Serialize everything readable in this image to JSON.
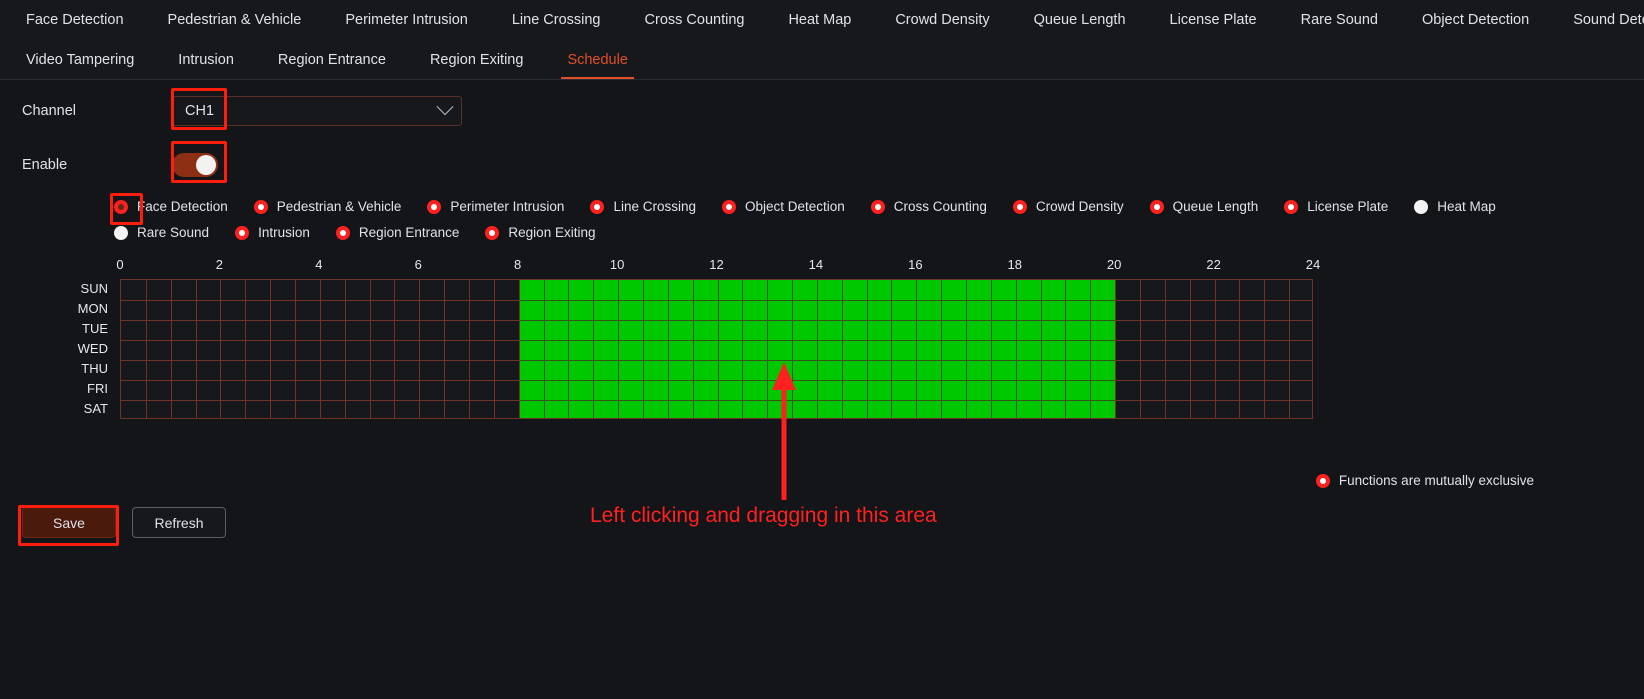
{
  "nav": {
    "row1": [
      {
        "label": "Face Detection",
        "active": false
      },
      {
        "label": "Pedestrian & Vehicle",
        "active": false
      },
      {
        "label": "Perimeter Intrusion",
        "active": false
      },
      {
        "label": "Line Crossing",
        "active": false
      },
      {
        "label": "Cross Counting",
        "active": false
      },
      {
        "label": "Heat Map",
        "active": false
      },
      {
        "label": "Crowd Density",
        "active": false
      },
      {
        "label": "Queue Length",
        "active": false
      },
      {
        "label": "License Plate",
        "active": false
      },
      {
        "label": "Rare Sound",
        "active": false
      },
      {
        "label": "Object Detection",
        "active": false
      },
      {
        "label": "Sound Detection",
        "active": false
      }
    ],
    "row2": [
      {
        "label": "Video Tampering",
        "active": false
      },
      {
        "label": "Intrusion",
        "active": false
      },
      {
        "label": "Region Entrance",
        "active": false
      },
      {
        "label": "Region Exiting",
        "active": false
      },
      {
        "label": "Schedule",
        "active": true
      }
    ]
  },
  "form": {
    "channel_label": "Channel",
    "channel_value": "CH1",
    "enable_label": "Enable",
    "enable_on": true
  },
  "functions": {
    "row1": [
      {
        "label": "Face Detection",
        "state": "selected"
      },
      {
        "label": "Pedestrian & Vehicle",
        "state": "radio"
      },
      {
        "label": "Perimeter Intrusion",
        "state": "radio"
      },
      {
        "label": "Line Crossing",
        "state": "radio"
      },
      {
        "label": "Object Detection",
        "state": "radio"
      },
      {
        "label": "Cross Counting",
        "state": "radio"
      },
      {
        "label": "Crowd Density",
        "state": "radio"
      },
      {
        "label": "Queue Length",
        "state": "radio"
      },
      {
        "label": "License Plate",
        "state": "radio"
      },
      {
        "label": "Heat Map",
        "state": "plain"
      }
    ],
    "row2": [
      {
        "label": "Rare Sound",
        "state": "plain"
      },
      {
        "label": "Intrusion",
        "state": "radio"
      },
      {
        "label": "Region Entrance",
        "state": "radio"
      },
      {
        "label": "Region Exiting",
        "state": "radio"
      }
    ]
  },
  "schedule": {
    "hour_ticks": [
      "0",
      "2",
      "4",
      "6",
      "8",
      "10",
      "12",
      "14",
      "16",
      "18",
      "20",
      "22",
      "24"
    ],
    "days": [
      "SUN",
      "MON",
      "TUE",
      "WED",
      "THU",
      "FRI",
      "SAT"
    ],
    "fill_start_hour": 8,
    "fill_end_hour": 20,
    "filled_days": [
      "SUN",
      "MON",
      "TUE",
      "WED",
      "THU",
      "FRI",
      "SAT"
    ],
    "fill_color": "#00c800",
    "grid_line_color": "#6e3425"
  },
  "legend": {
    "text": "Functions are mutually exclusive"
  },
  "buttons": {
    "save": "Save",
    "refresh": "Refresh"
  },
  "annotation": {
    "caption": "Left clicking and dragging in this area",
    "color": "#ff2020"
  }
}
